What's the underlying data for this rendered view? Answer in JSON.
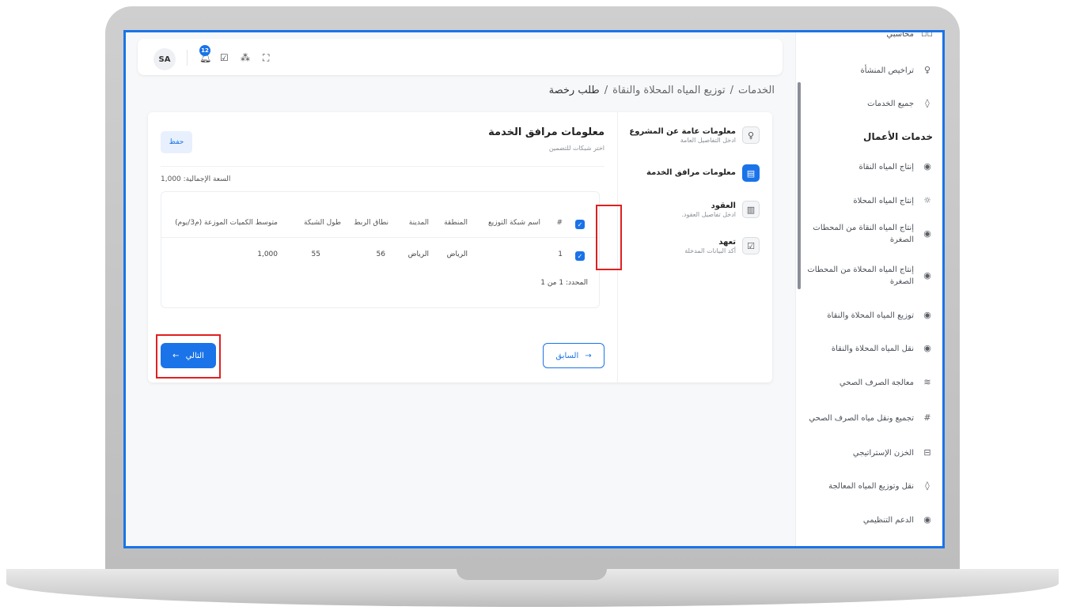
{
  "header": {
    "avatar_initials": "SA",
    "notification_count": "12",
    "icons": [
      "bell-icon",
      "clipboard-check-icon",
      "translate-icon",
      "fullscreen-icon"
    ]
  },
  "breadcrumb": {
    "items": [
      "الخدمات",
      "توزيع المياه المحلاة والنقاة",
      "طلب رخصة"
    ],
    "separator": "/"
  },
  "sidebar": {
    "top_items": [
      {
        "label": "محاسبي",
        "icon": "grid-icon"
      },
      {
        "label": "تراخيص المنشأة",
        "icon": "user-icon"
      },
      {
        "label": "جميع الخدمات",
        "icon": "drop-icon"
      }
    ],
    "section_title": "خدمات الأعمال",
    "items": [
      {
        "label": "إنتاج المياه النقاة",
        "icon": "water-drop-icon"
      },
      {
        "label": "إنتاج المياه المحلاة",
        "icon": "sun-icon"
      },
      {
        "label": "إنتاج المياه النقاة من المحطات الصغرة",
        "icon": "water-drop-icon"
      },
      {
        "label": "إنتاج المياه المحلاة من المحطات الصغرة",
        "icon": "water-drop-icon"
      },
      {
        "label": "توزيع المياه المحلاة والنقاة",
        "icon": "water-drop-icon"
      },
      {
        "label": "نقل المياه المحلاة والنقاة",
        "icon": "water-drop-icon"
      },
      {
        "label": "معالجة الصرف الصحي",
        "icon": "waves-icon"
      },
      {
        "label": "تجميع ونقل مياه الصرف الصحي",
        "icon": "hash-icon"
      },
      {
        "label": "الخزن الإستراتيجي",
        "icon": "storage-icon"
      },
      {
        "label": "نقل وتوزيع المياه المعالجة",
        "icon": "drop-icon"
      },
      {
        "label": "الدعم التنظيمي",
        "icon": "water-drop-icon"
      }
    ]
  },
  "steps": [
    {
      "title": "معلومات عامة عن المشروع",
      "subtitle": "ادخل التفاصيل العامة",
      "icon": "user-icon",
      "active": false
    },
    {
      "title": "معلومات مرافق الخدمة",
      "subtitle": "",
      "icon": "id-card-icon",
      "active": true
    },
    {
      "title": "العقود",
      "subtitle": "ادخل تفاصيل العقود.",
      "icon": "document-icon",
      "active": false
    },
    {
      "title": "تعهد",
      "subtitle": "أكد البيانات المدخلة",
      "icon": "checkbox-icon",
      "active": false
    }
  ],
  "content": {
    "title": "معلومات مرافق الخدمة",
    "subtitle": "اختر شبكات للتضمين",
    "save_label": "حفظ",
    "capacity_text": "السعة الإجمالية: 1,000",
    "table": {
      "columns": [
        "#",
        "اسم شبكة التوزيع",
        "المنطقة",
        "المدينة",
        "نطاق الربط",
        "طول الشبكة",
        "متوسط الكميات الموزعة (م3/يوم)"
      ],
      "rows": [
        {
          "checked": true,
          "num": "1",
          "name": "",
          "region": "الرياض",
          "city": "الرياض",
          "range": "56",
          "length": "55",
          "avg": "1,000"
        }
      ]
    },
    "paging_text": "المحدد: 1 من 1",
    "prev_label": "السابق",
    "next_label": "التالي"
  },
  "colors": {
    "accent": "#1a73e8",
    "highlight": "#e02020"
  }
}
